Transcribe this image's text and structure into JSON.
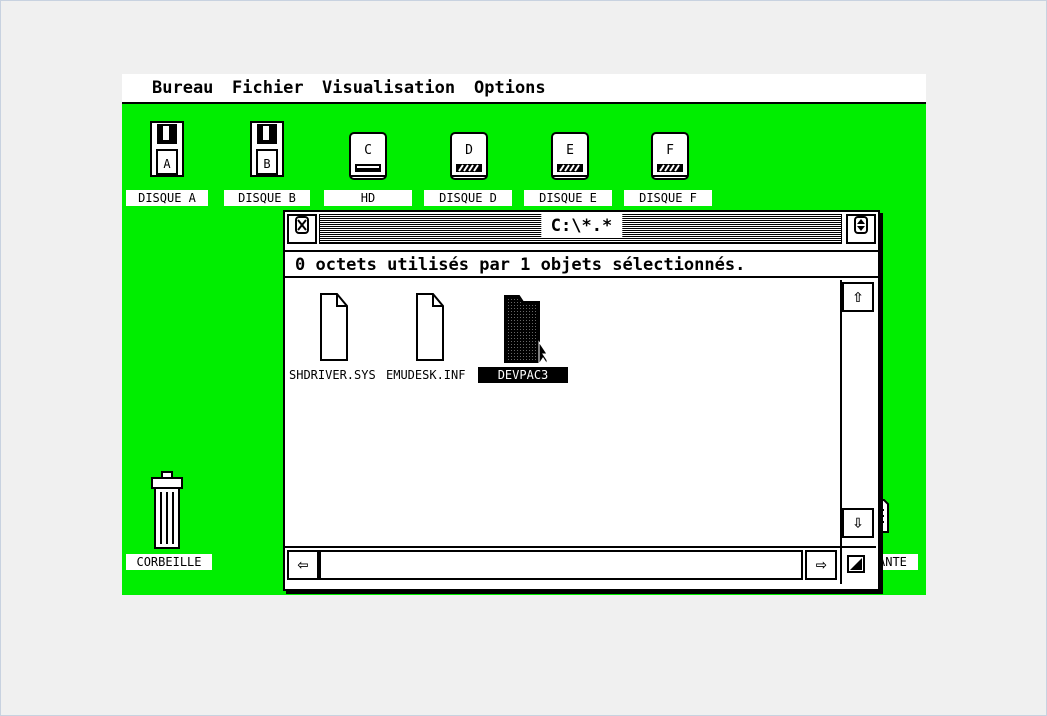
{
  "menubar": {
    "items": [
      "Bureau",
      "Fichier",
      "Visualisation",
      "Options"
    ]
  },
  "desktop": {
    "background": "#00ee00",
    "drives": [
      {
        "letter": "A",
        "label": "DISQUE A",
        "kind": "floppy"
      },
      {
        "letter": "B",
        "label": "DISQUE B",
        "kind": "floppy"
      },
      {
        "letter": "C",
        "label": "HD",
        "kind": "harddisk"
      },
      {
        "letter": "D",
        "label": "DISQUE D",
        "kind": "harddisk"
      },
      {
        "letter": "E",
        "label": "DISQUE E",
        "kind": "harddisk"
      },
      {
        "letter": "F",
        "label": "DISQUE F",
        "kind": "harddisk"
      }
    ],
    "trash_label": "CORBEILLE",
    "printer_label_partial": "ANTE"
  },
  "window": {
    "title": "C:\\*.*",
    "info": "0 octets utilisés par 1 objets sélectionnés.",
    "files": [
      {
        "name": "SHDRIVER.SYS",
        "kind": "document",
        "selected": false
      },
      {
        "name": "EMUDESK.INF",
        "kind": "document",
        "selected": false
      },
      {
        "name": "DEVPAC3",
        "kind": "folder",
        "selected": true
      }
    ],
    "icons": {
      "close": "close-icon",
      "full": "fullscreen-icon",
      "up": "arrow-up-icon",
      "down": "arrow-down-icon",
      "left": "arrow-left-icon",
      "right": "arrow-right-icon",
      "size": "resize-icon"
    }
  }
}
